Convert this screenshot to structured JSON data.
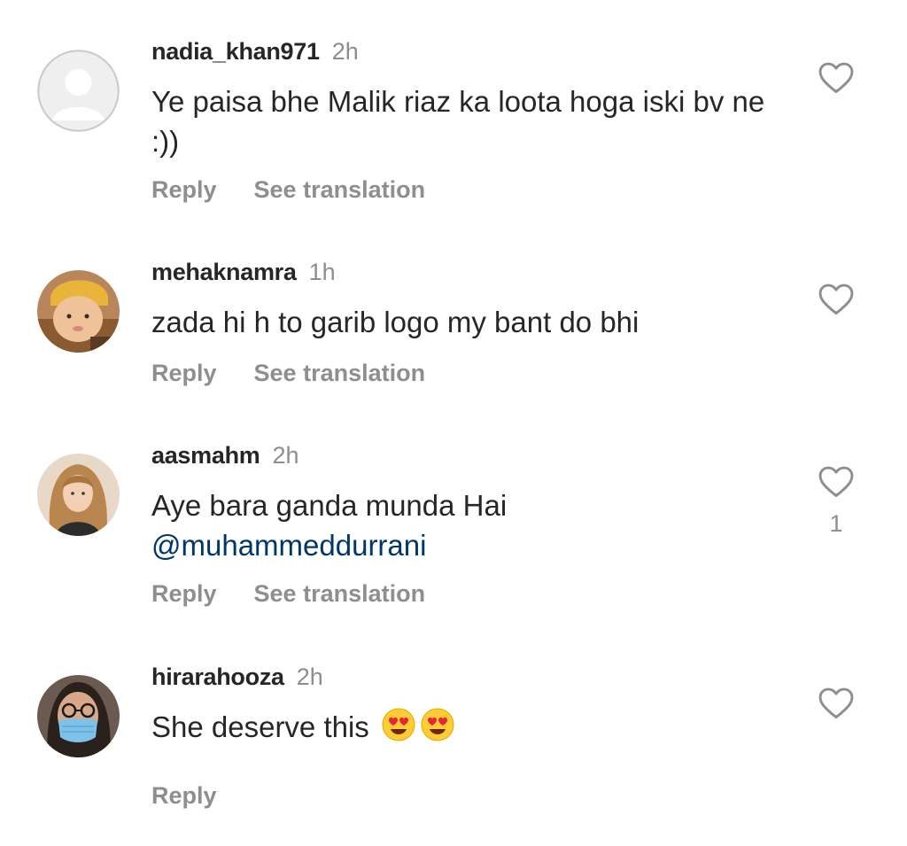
{
  "comments": [
    {
      "username": "nadia_khan971",
      "time": "2h",
      "text": "Ye paisa bhe Malik riaz ka loota hoga iski bv ne :))",
      "mention": "",
      "actions": [
        "Reply",
        "See translation"
      ],
      "likes": "",
      "avatar": "default-avatar"
    },
    {
      "username": "mehaknamra",
      "time": "1h",
      "text": "zada hi h to garib logo my bant do bhi",
      "mention": "",
      "actions": [
        "Reply",
        "See translation"
      ],
      "likes": "",
      "avatar": "child-photo"
    },
    {
      "username": "aasmahm",
      "time": "2h",
      "text": "Aye bara ganda munda Hai",
      "mention": "@muhammeddurrani",
      "actions": [
        "Reply",
        "See translation"
      ],
      "likes": "1",
      "avatar": "woman-photo"
    },
    {
      "username": "hirarahooza",
      "time": "2h",
      "text": "She deserve this",
      "emoji": [
        "heart-eyes-emoji",
        "heart-eyes-emoji"
      ],
      "mention": "",
      "actions": [
        "Reply"
      ],
      "likes": "",
      "avatar": "masked-woman-photo"
    }
  ],
  "icons": {
    "like": "heart-outline-icon"
  },
  "colors": {
    "text": "#262626",
    "secondary": "#8e8e8e",
    "mention": "#00376b",
    "background": "#ffffff"
  }
}
